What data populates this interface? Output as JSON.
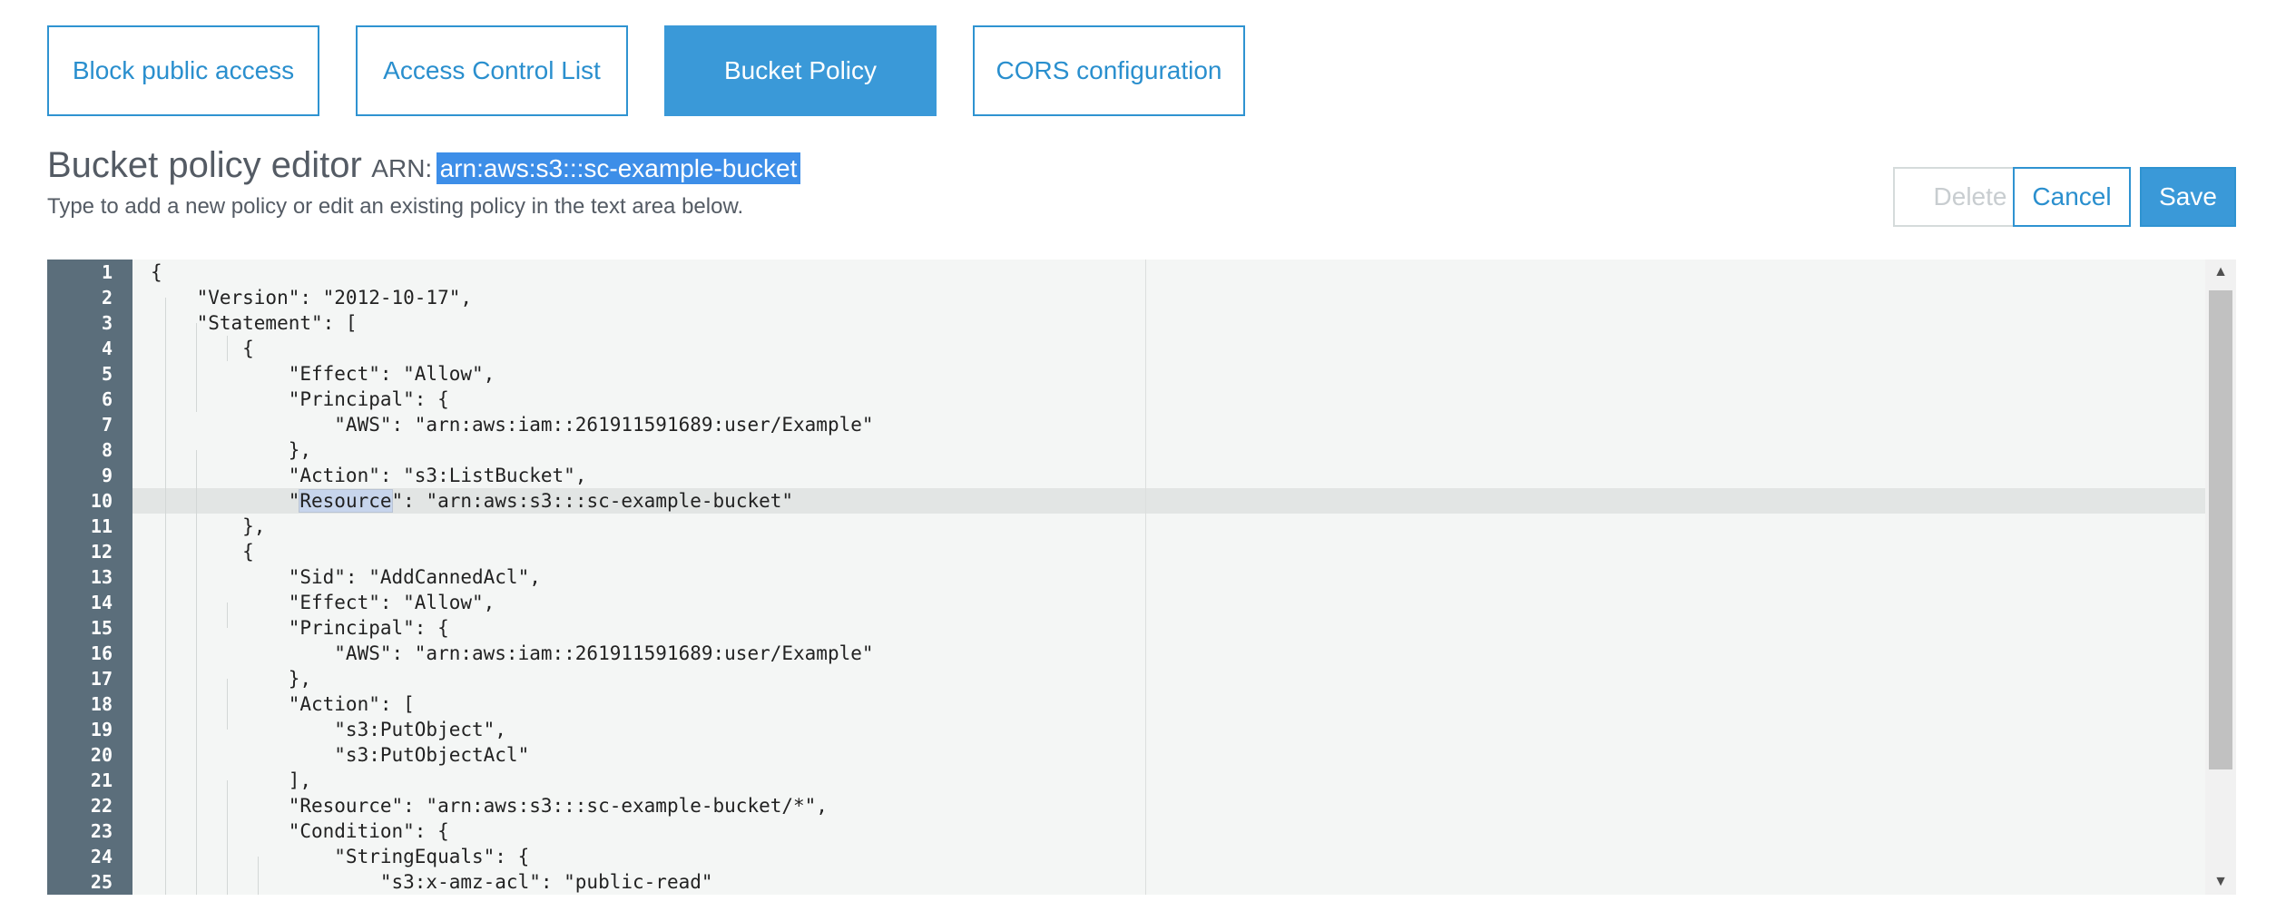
{
  "tabs": [
    {
      "label": "Block public access",
      "active": false
    },
    {
      "label": "Access Control List",
      "active": false
    },
    {
      "label": "Bucket Policy",
      "active": true
    },
    {
      "label": "CORS configuration",
      "active": false
    }
  ],
  "editor_header": {
    "title": "Bucket policy editor",
    "arn_prefix": "ARN:",
    "arn_value": "arn:aws:s3:::sc-example-bucket",
    "subtitle": "Type to add a new policy or edit an existing policy in the text area below."
  },
  "actions": {
    "delete_label": "Delete",
    "cancel_label": "Cancel",
    "save_label": "Save"
  },
  "code": {
    "highlighted_line": 10,
    "lines": [
      {
        "n": "1",
        "text": "{"
      },
      {
        "n": "2",
        "text": "    \"Version\": \"2012-10-17\","
      },
      {
        "n": "3",
        "text": "    \"Statement\": ["
      },
      {
        "n": "4",
        "text": "        {"
      },
      {
        "n": "5",
        "text": "            \"Effect\": \"Allow\","
      },
      {
        "n": "6",
        "text": "            \"Principal\": {"
      },
      {
        "n": "7",
        "text": "                \"AWS\": \"arn:aws:iam::261911591689:user/Example\""
      },
      {
        "n": "8",
        "text": "            },"
      },
      {
        "n": "9",
        "text": "            \"Action\": \"s3:ListBucket\","
      },
      {
        "n": "10",
        "text": "            \"Resource\": \"arn:aws:s3:::sc-example-bucket\""
      },
      {
        "n": "11",
        "text": "        },"
      },
      {
        "n": "12",
        "text": "        {"
      },
      {
        "n": "13",
        "text": "            \"Sid\": \"AddCannedAcl\","
      },
      {
        "n": "14",
        "text": "            \"Effect\": \"Allow\","
      },
      {
        "n": "15",
        "text": "            \"Principal\": {"
      },
      {
        "n": "16",
        "text": "                \"AWS\": \"arn:aws:iam::261911591689:user/Example\""
      },
      {
        "n": "17",
        "text": "            },"
      },
      {
        "n": "18",
        "text": "            \"Action\": ["
      },
      {
        "n": "19",
        "text": "                \"s3:PutObject\","
      },
      {
        "n": "20",
        "text": "                \"s3:PutObjectAcl\""
      },
      {
        "n": "21",
        "text": "            ],"
      },
      {
        "n": "22",
        "text": "            \"Resource\": \"arn:aws:s3:::sc-example-bucket/*\","
      },
      {
        "n": "23",
        "text": "            \"Condition\": {"
      },
      {
        "n": "24",
        "text": "                \"StringEquals\": {"
      },
      {
        "n": "25",
        "text": "                    \"s3:x-amz-acl\": \"public-read\""
      }
    ]
  },
  "colors": {
    "accent": "#3a99d8",
    "gutter": "#5b6e7b",
    "selection": "#3d8ee8"
  },
  "icons": {
    "scroll_up": "triangle-up-icon",
    "scroll_down": "triangle-down-icon"
  }
}
